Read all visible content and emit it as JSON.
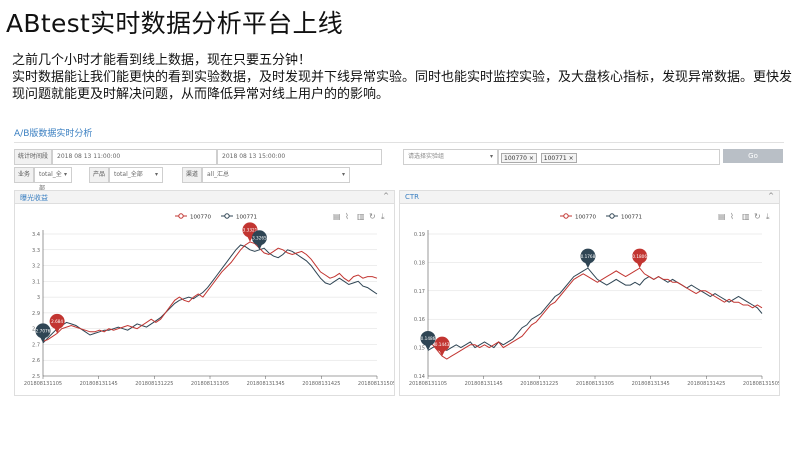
{
  "slide": {
    "title": "ABtest实时数据分析平台上线",
    "line1": "之前几个小时才能看到线上数据，现在只要五分钟！",
    "line2": "实时数据能让我们能更快的看到实验数据，及时发现并下线异常实验。同时也能实时监控实验，及大盘核心指标，发现异常数据。更快发现问题就能更及时解决问题，从而降低异常对线上用户的的影响。"
  },
  "dashboard": {
    "title": "A/B版数据实时分析",
    "filters": {
      "time_label": "统计时间段",
      "start_time": "2018 08 13 11:00:00",
      "end_time": "2018 08 13 15:00:00",
      "experiment_placeholder": "请选择实验组",
      "selected_tags": [
        "100770",
        "100771"
      ],
      "go_label": "Go",
      "biz_label": "业务",
      "biz_value": "total_全部",
      "product_label": "产品",
      "product_value": "total_全部",
      "channel_label": "渠道",
      "channel_value": "all_汇总"
    },
    "colors": {
      "series_a": "#c23531",
      "series_b": "#2f4554",
      "accent": "#3a7fc1"
    },
    "toolbar_icons": [
      "data-view-icon",
      "line-chart-icon",
      "bar-chart-icon",
      "refresh-icon",
      "download-icon"
    ]
  },
  "chart_data": [
    {
      "type": "line",
      "title": "曝光收益",
      "series": [
        {
          "name": "100770",
          "values": [
            2.72,
            2.73,
            2.75,
            2.77,
            2.8,
            2.81,
            2.82,
            2.81,
            2.8,
            2.79,
            2.78,
            2.78,
            2.79,
            2.78,
            2.8,
            2.79,
            2.8,
            2.81,
            2.82,
            2.81,
            2.8,
            2.82,
            2.84,
            2.86,
            2.84,
            2.86,
            2.9,
            2.94,
            2.98,
            3.0,
            2.98,
            2.97,
            3.0,
            3.02,
            3.0,
            3.04,
            3.08,
            3.12,
            3.16,
            3.19,
            3.22,
            3.26,
            3.3,
            3.33,
            3.35,
            3.34,
            3.31,
            3.28,
            3.27,
            3.29,
            3.31,
            3.3,
            3.28,
            3.27,
            3.28,
            3.29,
            3.27,
            3.24,
            3.2,
            3.16,
            3.14,
            3.12,
            3.13,
            3.15,
            3.12,
            3.1,
            3.13,
            3.14,
            3.12,
            3.13,
            3.13,
            3.12
          ]
        },
        {
          "name": "100771",
          "values": [
            2.71,
            2.74,
            2.77,
            2.8,
            2.82,
            2.84,
            2.83,
            2.82,
            2.8,
            2.78,
            2.76,
            2.77,
            2.78,
            2.79,
            2.79,
            2.8,
            2.81,
            2.8,
            2.79,
            2.81,
            2.83,
            2.82,
            2.81,
            2.83,
            2.85,
            2.87,
            2.9,
            2.93,
            2.96,
            2.98,
            2.99,
            3.0,
            2.99,
            3.01,
            3.03,
            3.06,
            3.1,
            3.14,
            3.18,
            3.22,
            3.26,
            3.3,
            3.33,
            3.32,
            3.3,
            3.29,
            3.3,
            3.31,
            3.28,
            3.26,
            3.25,
            3.27,
            3.3,
            3.29,
            3.27,
            3.25,
            3.23,
            3.2,
            3.16,
            3.12,
            3.09,
            3.08,
            3.1,
            3.12,
            3.1,
            3.08,
            3.09,
            3.1,
            3.07,
            3.06,
            3.04,
            3.02
          ]
        }
      ],
      "x_ticks": [
        "201808131105",
        "201808131145",
        "201808131225",
        "201808131305",
        "201808131345",
        "201808131425",
        "201808131505"
      ],
      "y_ticks": [
        "2.5",
        "2.6",
        "2.7",
        "2.8",
        "2.9",
        "3",
        "3.1",
        "3.2",
        "3.3",
        "3.4"
      ],
      "ylim": [
        2.5,
        3.4
      ],
      "markers": [
        {
          "series": 1,
          "index": 0,
          "label": "2.7076"
        },
        {
          "series": 0,
          "index": 3,
          "label": "2.684"
        },
        {
          "series": 0,
          "index": 44,
          "label": "3.3321"
        },
        {
          "series": 1,
          "index": 46,
          "label": "3.3265"
        }
      ],
      "legend_position": "top-center",
      "grid": true
    },
    {
      "type": "line",
      "title": "CTR",
      "series": [
        {
          "name": "100770",
          "values": [
            0.152,
            0.151,
            0.149,
            0.147,
            0.146,
            0.147,
            0.148,
            0.149,
            0.15,
            0.151,
            0.151,
            0.15,
            0.151,
            0.15,
            0.151,
            0.152,
            0.15,
            0.151,
            0.152,
            0.153,
            0.154,
            0.156,
            0.158,
            0.159,
            0.161,
            0.163,
            0.165,
            0.166,
            0.168,
            0.17,
            0.172,
            0.174,
            0.175,
            0.176,
            0.175,
            0.174,
            0.173,
            0.174,
            0.175,
            0.176,
            0.177,
            0.176,
            0.175,
            0.176,
            0.177,
            0.178,
            0.176,
            0.175,
            0.174,
            0.175,
            0.174,
            0.174,
            0.173,
            0.173,
            0.172,
            0.171,
            0.17,
            0.169,
            0.17,
            0.17,
            0.169,
            0.168,
            0.167,
            0.166,
            0.167,
            0.166,
            0.166,
            0.165,
            0.165,
            0.164,
            0.165,
            0.164
          ]
        },
        {
          "name": "100771",
          "values": [
            0.149,
            0.15,
            0.151,
            0.15,
            0.149,
            0.15,
            0.151,
            0.15,
            0.151,
            0.152,
            0.15,
            0.151,
            0.152,
            0.151,
            0.15,
            0.152,
            0.151,
            0.152,
            0.153,
            0.155,
            0.157,
            0.158,
            0.16,
            0.161,
            0.162,
            0.164,
            0.166,
            0.168,
            0.169,
            0.171,
            0.173,
            0.175,
            0.176,
            0.177,
            0.178,
            0.176,
            0.174,
            0.173,
            0.172,
            0.173,
            0.174,
            0.173,
            0.172,
            0.172,
            0.173,
            0.172,
            0.174,
            0.175,
            0.174,
            0.175,
            0.174,
            0.173,
            0.174,
            0.173,
            0.172,
            0.171,
            0.172,
            0.171,
            0.17,
            0.169,
            0.168,
            0.169,
            0.168,
            0.167,
            0.166,
            0.167,
            0.168,
            0.167,
            0.166,
            0.165,
            0.164,
            0.162
          ]
        }
      ],
      "x_ticks": [
        "201808131105",
        "201808131145",
        "201808131225",
        "201808131305",
        "201808131345",
        "201808131425",
        "201808131505"
      ],
      "y_ticks": [
        "0.14",
        "0.15",
        "0.16",
        "0.17",
        "0.18",
        "0.19"
      ],
      "ylim": [
        0.14,
        0.19
      ],
      "markers": [
        {
          "series": 1,
          "index": 0,
          "label": "0.1486"
        },
        {
          "series": 0,
          "index": 3,
          "label": "0.1443"
        },
        {
          "series": 1,
          "index": 34,
          "label": "0.1768"
        },
        {
          "series": 0,
          "index": 45,
          "label": "0.1806"
        }
      ],
      "legend_position": "top-center",
      "grid": true
    }
  ]
}
